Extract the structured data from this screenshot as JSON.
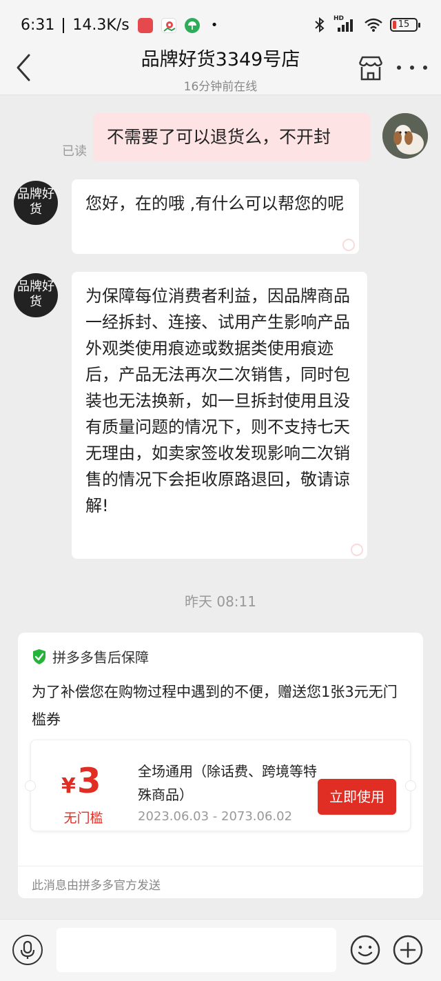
{
  "status_bar": {
    "time": "6:31",
    "net_speed": "14.3K/s",
    "battery": "15",
    "signal_label": "HD"
  },
  "header": {
    "title": "品牌好货3349号店",
    "subtitle": "16分钟前在线"
  },
  "messages": [
    {
      "from": "user",
      "text": "不需要了可以退货么，不开封",
      "status": "已读"
    },
    {
      "from": "shop",
      "avatar_text": "品牌好货",
      "text": "您好，在的哦 ,有什么可以帮您的呢"
    },
    {
      "from": "shop",
      "avatar_text": "品牌好货",
      "text": "为保障每位消费者利益，因品牌商品一经拆封、连接、试用产生影响产品外观类使用痕迹或数据类使用痕迹后，产品无法再次二次销售，同时包装也无法换新，如一旦拆封使用且没有质量问题的情况下，则不支持七天无理由，如卖家签收发现影响二次销售的情况下会拒收原路退回，敬请谅解!"
    }
  ],
  "timestamp": "昨天 08:11",
  "card": {
    "title": "拼多多售后保障",
    "body": "为了补偿您在购物过程中遇到的不便，赠送您1张3元无门槛券",
    "coupon": {
      "currency": "¥",
      "amount": "3",
      "condition": "无门槛",
      "description": "全场通用（除话费、跨境等特殊商品）",
      "validity": "2023.06.03 - 2073.06.02",
      "button_label": "立即使用"
    },
    "footer": "此消息由拼多多官方发送"
  },
  "input_bar": {
    "placeholder": ""
  },
  "colors": {
    "accent_red": "#e02e24",
    "user_bubble": "#fde3e3",
    "shield_green": "#25b33a"
  }
}
